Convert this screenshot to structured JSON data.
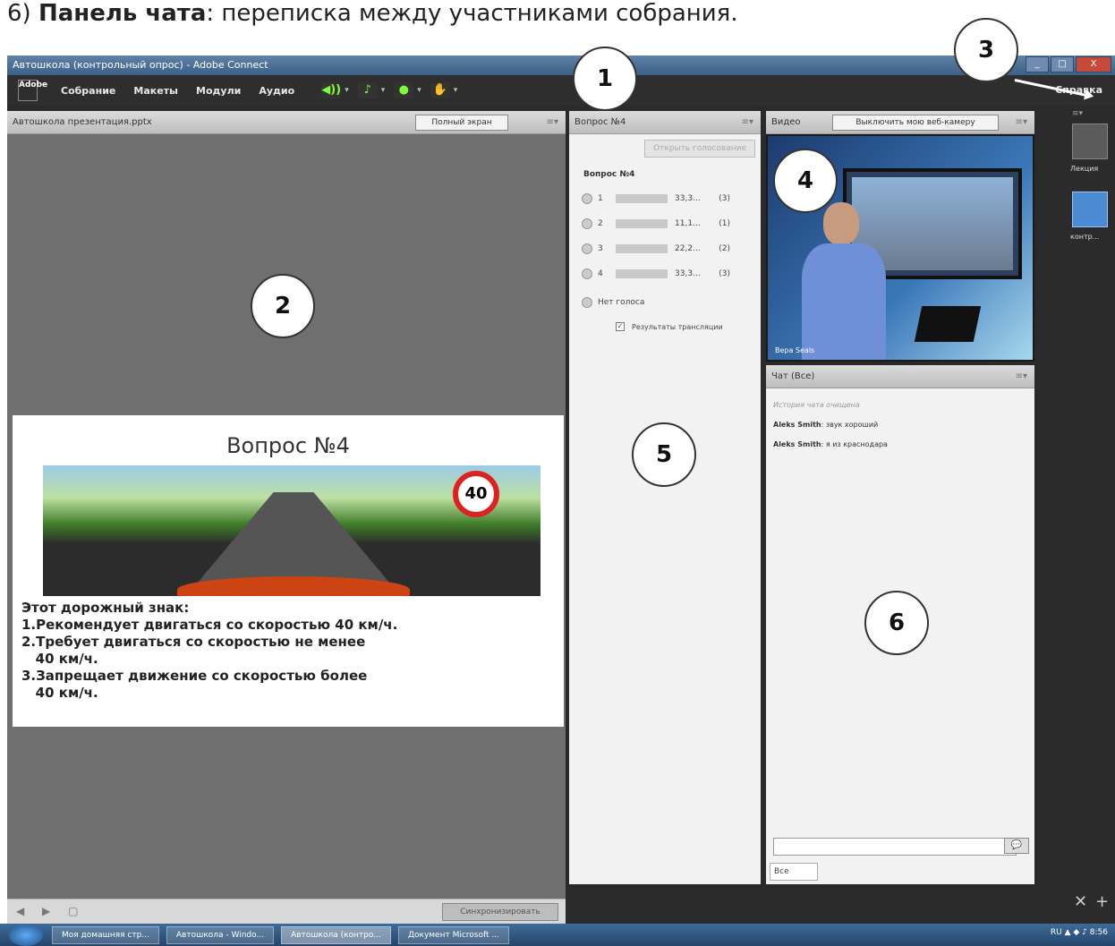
{
  "caption": {
    "num": "6)",
    "bold": "Панель чата",
    "rest": ": переписка между участниками собрания."
  },
  "window": {
    "title": "Автошкола (контрольный опрос) - Adobe Connect",
    "btn_min": "_",
    "btn_max": "□",
    "btn_close": "X"
  },
  "menubar": {
    "logo": "Adobe",
    "items": [
      "Собрание",
      "Макеты",
      "Модули",
      "Аудио"
    ],
    "help": "Справка",
    "tools": [
      {
        "icon": "speaker-icon",
        "glyph": "◀))"
      },
      {
        "icon": "microphone-icon",
        "glyph": "♪"
      },
      {
        "icon": "webcam-icon",
        "glyph": "●"
      },
      {
        "icon": "raise-hand-icon",
        "glyph": "✋"
      }
    ]
  },
  "share_pod": {
    "title": "Автошкола презентация.pptx",
    "fullscreen_label": "Полный экран",
    "menu_glyph": "≡▾",
    "sync_label": "Синхронизировать",
    "nav_glyphs": "◀ ▶ ▢"
  },
  "slide": {
    "title": "Вопрос №4",
    "sign_value": "40",
    "lines": [
      "Этот дорожный знак:",
      "1.Рекомендует двигаться со скоростью 40 км/ч.",
      "2.Требует двигаться со скоростью не менее",
      "   40 км/ч.",
      "3.Запрещает движение со скоростью более",
      "   40 км/ч."
    ]
  },
  "poll_pod": {
    "title": "Вопрос №4",
    "open_button": "Открыть голосование",
    "question": "Вопрос №4",
    "answers": [
      {
        "num": "1",
        "fraction": 0.333,
        "pct": "33,3...",
        "count": "(3)"
      },
      {
        "num": "2",
        "fraction": 0.111,
        "pct": "11,1...",
        "count": "(1)"
      },
      {
        "num": "3",
        "fraction": 0.222,
        "pct": "22,2...",
        "count": "(2)"
      },
      {
        "num": "4",
        "fraction": 0.333,
        "pct": "33,3...",
        "count": "(3)"
      }
    ],
    "no_vote": "Нет голоса",
    "broadcast": "Результаты трансляции"
  },
  "video_pod": {
    "title": "Видео",
    "stop_button": "Выключить мою веб-камеру",
    "presenter_label": "Вера Seals"
  },
  "chat_pod": {
    "title": "Чат  (Все)",
    "history_note": "История чата очищена",
    "messages": [
      {
        "author": "Aleks Smith",
        "text": "звук хороший"
      },
      {
        "author": "Aleks Smith",
        "text": "я из краснодара"
      }
    ],
    "tab": "Все",
    "send_glyph": "💬"
  },
  "layouts": {
    "items": [
      "Лекция",
      "контр..."
    ],
    "menu_glyph": "≡▾"
  },
  "taskbar": {
    "items": [
      "Моя домашняя стр...",
      "Автошкола - Windo...",
      "Автошкола (контро...",
      "Документ Microsoft ..."
    ],
    "tray": "RU  ▲ ◆ ♪  8:56"
  },
  "badges": [
    "1",
    "2",
    "3",
    "4",
    "5",
    "6"
  ]
}
